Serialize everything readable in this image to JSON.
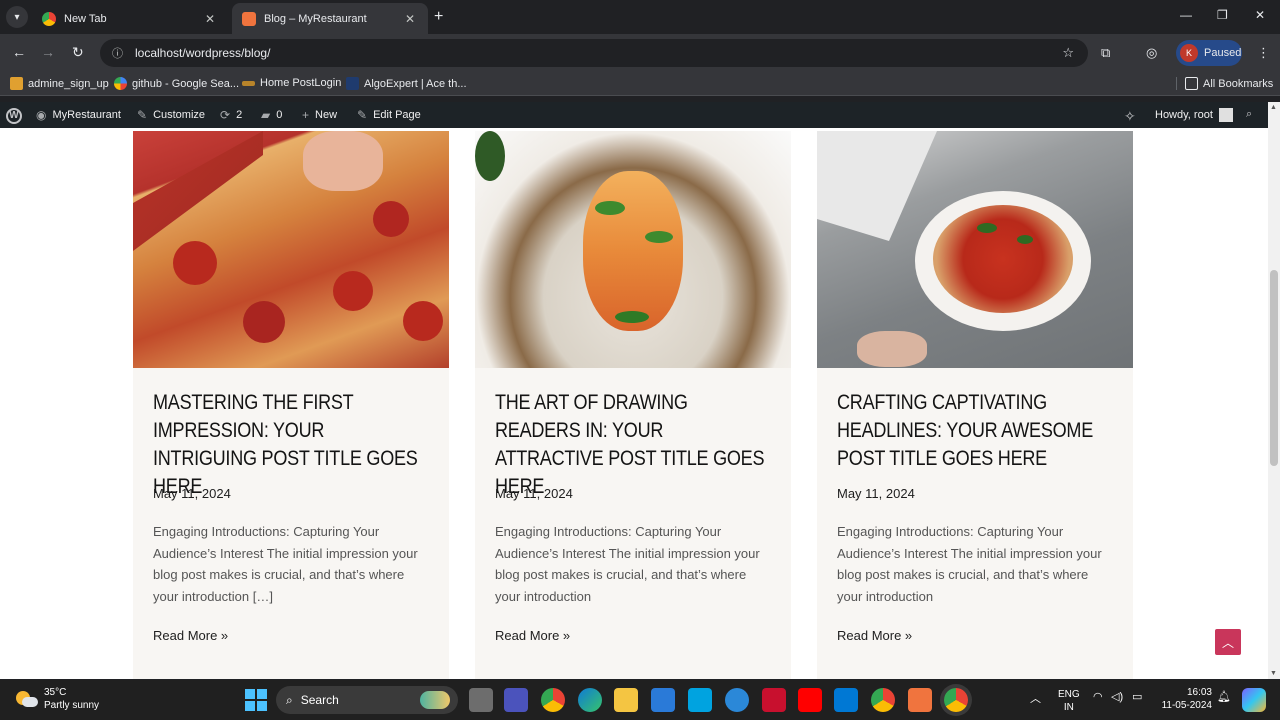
{
  "browser": {
    "tabs": [
      {
        "title": "New Tab",
        "icon": "chrome-icon"
      },
      {
        "title": "Blog – MyRestaurant",
        "icon": "site-icon",
        "active": true
      }
    ],
    "url": "localhost/wordpress/blog/",
    "profile_label": "Paused",
    "profile_initial": "K",
    "bookmarks": [
      {
        "label": "admine_sign_up"
      },
      {
        "label": "github - Google Sea..."
      },
      {
        "label": "Home PostLogin"
      },
      {
        "label": "AlgoExpert | Ace th..."
      }
    ],
    "all_bookmarks": "All Bookmarks"
  },
  "adminbar": {
    "site": "MyRestaurant",
    "customize": "Customize",
    "updates": "2",
    "comments": "0",
    "new": "New",
    "edit": "Edit Page",
    "howdy": "Howdy, root"
  },
  "posts": [
    {
      "title": "MASTERING THE FIRST IMPRESSION: YOUR INTRIGUING POST TITLE GOES HERE",
      "date": "May 11, 2024",
      "excerpt": "Engaging Introductions: Capturing Your Audience’s Interest The initial impression your blog post makes is crucial, and that’s where your introduction […]",
      "more": "Read More »"
    },
    {
      "title": "THE ART OF DRAWING READERS IN: YOUR ATTRACTIVE POST TITLE GOES HERE",
      "date": "May 11, 2024",
      "excerpt": "Engaging Introductions: Capturing Your Audience’s Interest The initial impression your blog post makes is crucial, and that’s where your introduction",
      "more": "Read More »"
    },
    {
      "title": "CRAFTING CAPTIVATING HEADLINES: YOUR AWESOME POST TITLE GOES HERE",
      "date": "May 11, 2024",
      "excerpt": "Engaging Introductions: Capturing Your Audience’s Interest The initial impression your blog post makes is crucial, and that’s where your introduction",
      "more": "Read More »"
    }
  ],
  "taskbar": {
    "temp": "35°C",
    "weather": "Partly sunny",
    "search": "Search",
    "lang1": "ENG",
    "lang2": "IN",
    "time": "16:03",
    "date": "11-05-2024"
  },
  "colors": {
    "accent": "#c9365b",
    "card_bg": "#f8f6f3",
    "adminbar": "#1d2327"
  }
}
